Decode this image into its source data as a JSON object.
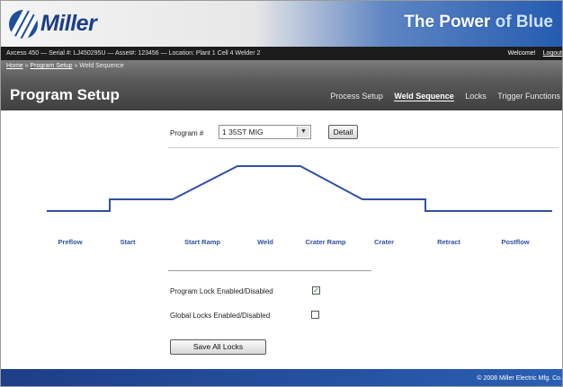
{
  "brand": {
    "logo_text": "Miller",
    "tagline_part1": "The Power",
    "tagline_part2": "of",
    "tagline_part3": "Blue",
    "brand_color": "#1f4e9a"
  },
  "infobar": {
    "device_info": "Axcess 450 — Serial #: LJ450295U — Asset#: 123456 — Location: Plant 1 Cell 4 Welder 2",
    "welcome": "Welcome!",
    "logout": "Logout"
  },
  "breadcrumb": {
    "home": "Home",
    "sep1": "»",
    "program_setup": "Program Setup",
    "sep2": "»",
    "current": "Weld Sequence"
  },
  "page": {
    "title": "Program Setup"
  },
  "tabs": [
    {
      "label": "Process Setup",
      "active": false
    },
    {
      "label": "Weld Sequence",
      "active": true
    },
    {
      "label": "Locks",
      "active": false
    },
    {
      "label": "Trigger Functions",
      "active": false
    }
  ],
  "program": {
    "label": "Program #",
    "selected": "1 35ST MIG",
    "detail_label": "Detail"
  },
  "sequence": {
    "line_color": "#2f50a3",
    "stages": [
      "Preflow",
      "Start",
      "Start Ramp",
      "Weld",
      "Crater Ramp",
      "Crater",
      "Retract",
      "Postflow"
    ]
  },
  "locks": {
    "program_lock_label": "Program Lock Enabled/Disabled",
    "program_lock_checked": true,
    "global_lock_label": "Global Locks Enabled/Disabled",
    "global_lock_checked": false,
    "check_mark": "✓",
    "save_label": "Save All Locks"
  },
  "footer": {
    "copyright": "© 2008 Miller Electric Mfg. Co."
  }
}
